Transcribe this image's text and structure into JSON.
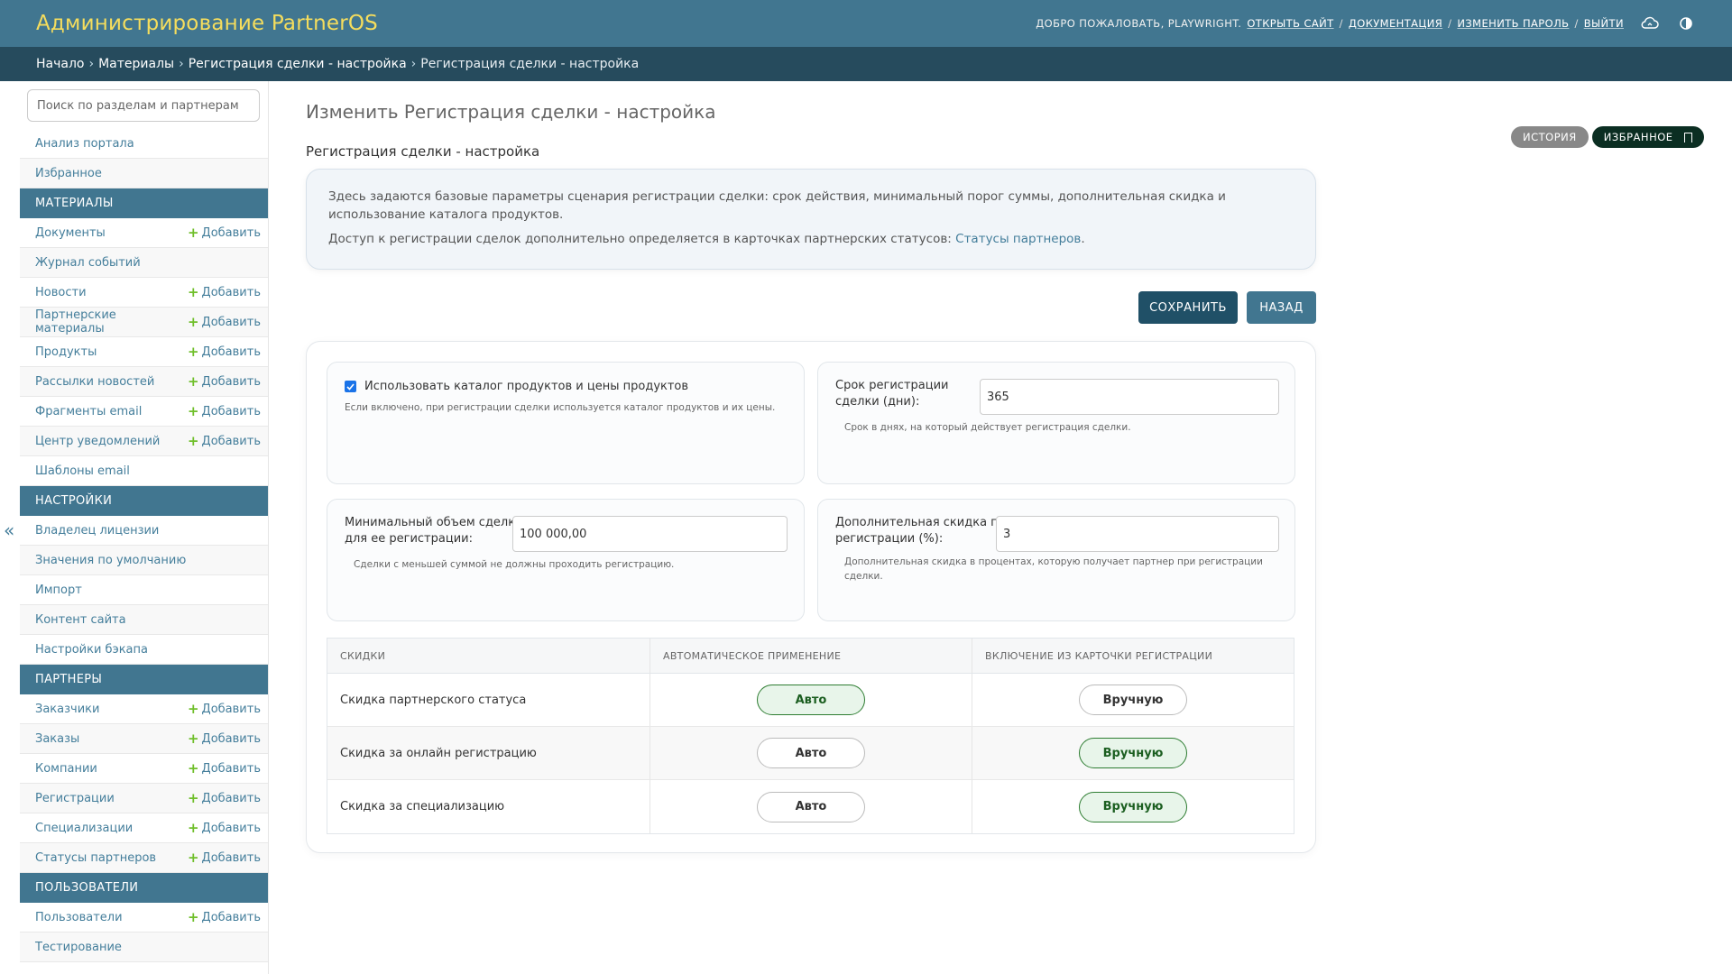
{
  "header": {
    "brand": "Администрирование PartnerOS",
    "welcome": "Добро пожаловать,",
    "username": "playwright",
    "links": {
      "open_site": "Открыть сайт",
      "docs": "Документация",
      "change_password": "Изменить пароль",
      "logout": "Выйти"
    },
    "icons": [
      "cloud-icon",
      "theme-toggle-icon"
    ]
  },
  "breadcrumbs": {
    "items": [
      "Начало",
      "Материалы",
      "Регистрация сделки - настройка"
    ],
    "current": "Регистрация сделки - настройка"
  },
  "sidebar": {
    "search_placeholder": "Поиск по разделам и партнерам",
    "add_label": "Добавить",
    "top_items": [
      "Анализ портала",
      "Избранное"
    ],
    "sections": [
      {
        "title": "Материалы",
        "items": [
          {
            "label": "Документы",
            "add": true
          },
          {
            "label": "Журнал событий",
            "add": false
          },
          {
            "label": "Новости",
            "add": true
          },
          {
            "label": "Партнерские материалы",
            "add": true
          },
          {
            "label": "Продукты",
            "add": true
          },
          {
            "label": "Рассылки новостей",
            "add": true
          },
          {
            "label": "Фрагменты email",
            "add": true
          },
          {
            "label": "Центр уведомлений",
            "add": true
          },
          {
            "label": "Шаблоны email",
            "add": false
          }
        ]
      },
      {
        "title": "Настройки",
        "items": [
          {
            "label": "Владелец лицензии",
            "add": false
          },
          {
            "label": "Значения по умолчанию",
            "add": false
          },
          {
            "label": "Импорт",
            "add": false
          },
          {
            "label": "Контент сайта",
            "add": false
          },
          {
            "label": "Настройки бэкапа",
            "add": false
          }
        ]
      },
      {
        "title": "Партнеры",
        "items": [
          {
            "label": "Заказчики",
            "add": true
          },
          {
            "label": "Заказы",
            "add": true
          },
          {
            "label": "Компании",
            "add": true
          },
          {
            "label": "Регистрации",
            "add": true
          },
          {
            "label": "Специализации",
            "add": true
          },
          {
            "label": "Статусы партнеров",
            "add": true
          }
        ]
      },
      {
        "title": "Пользователи",
        "items": [
          {
            "label": "Пользователи",
            "add": true
          },
          {
            "label": "Тестирование",
            "add": false
          }
        ]
      }
    ]
  },
  "main": {
    "title": "Изменить Регистрация сделки - настройка",
    "subtitle": "Регистрация сделки - настройка",
    "object_tools": {
      "history": "История",
      "favorite": "Избранное"
    },
    "info": {
      "line1": "Здесь задаются базовые параметры сценария регистрации сделки: срок действия, минимальный порог суммы, дополнительная скидка и использование каталога продуктов.",
      "line2_prefix": "Доступ к регистрации сделок дополнительно определяется в карточках партнерских статусов: ",
      "line2_link": "Статусы партнеров",
      "line2_suffix": "."
    },
    "buttons": {
      "save": "Сохранить",
      "back": "Назад"
    },
    "fields": {
      "catalog": {
        "label": "Использовать каталог продуктов и цены продуктов",
        "checked": true,
        "help": "Если включено, при регистрации сделки используется каталог продуктов и их цены."
      },
      "term": {
        "label_l1": "Срок регистрации",
        "label_l2": "сделки (дни):",
        "value": "365",
        "help": "Срок в днях, на который действует регистрация сделки."
      },
      "min_amount": {
        "label_l1": "Минимальный объем сделки",
        "label_l2": "для ее регистрации:",
        "value": "100 000,00",
        "help": "Сделки с меньшей суммой не должны проходить регистрацию."
      },
      "extra_discount": {
        "label_l1": "Дополнительная скидка при",
        "label_l2": "регистрации (%):",
        "value": "3",
        "help_l1": "Дополнительная скидка в процентах, которую получает партнер при регистрации",
        "help_l2": "сделки."
      }
    },
    "table": {
      "headers": [
        "Скидки",
        "Автоматическое применение",
        "Включение из карточки регистрации"
      ],
      "auto_label": "Авто",
      "manual_label": "Вручную",
      "rows": [
        {
          "name": "Скидка партнерского статуса",
          "auto": true,
          "manual": false
        },
        {
          "name": "Скидка за онлайн регистрацию",
          "auto": false,
          "manual": true
        },
        {
          "name": "Скидка за специализацию",
          "auto": false,
          "manual": true
        }
      ]
    }
  }
}
